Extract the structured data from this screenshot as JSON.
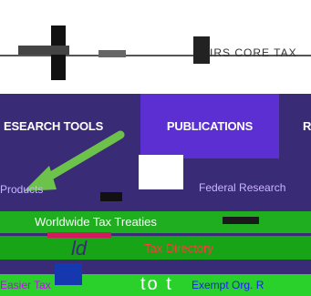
{
  "header": {
    "site_text": "IRS CORE TAX"
  },
  "nav": {
    "items": [
      {
        "label": "ESEARCH TOOLS"
      },
      {
        "label": "PUBLICATIONS"
      },
      {
        "label": "R"
      }
    ]
  },
  "dropdown": {
    "row1_left": "Products",
    "row1_right": "Federal Research",
    "row2_item": "Worldwide Tax Treaties",
    "row3_fragment": "ld",
    "row3_item": "Tax Directory",
    "row4_left": "Easier Tax",
    "row4_fragment": "to t",
    "row4_right": "Exempt Org. R"
  },
  "colors": {
    "nav_bg": "#3a2b77",
    "nav_active": "#5b2fd2",
    "accent_green": "#1fae1f",
    "arrow_green": "#6cc24a"
  }
}
